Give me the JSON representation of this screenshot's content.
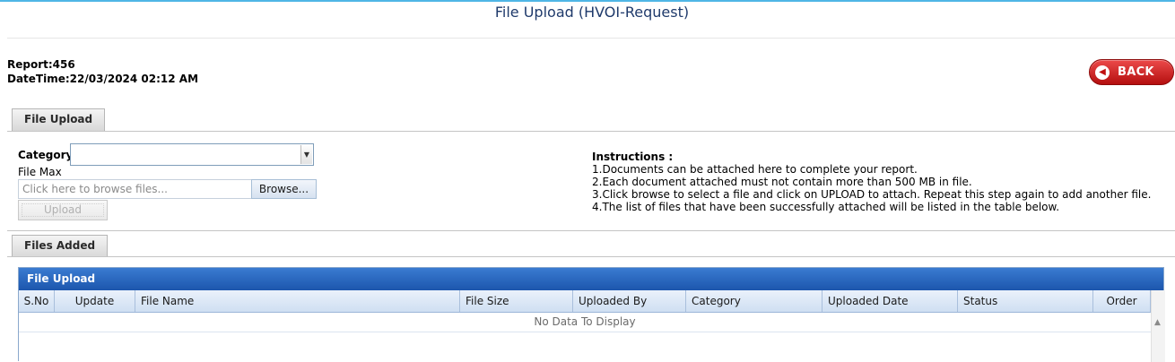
{
  "page": {
    "title": "File Upload (HVOI-Request)"
  },
  "report": {
    "report_line": "Report:456",
    "datetime_line": "DateTime:22/03/2024 02:12 AM"
  },
  "back_button": {
    "label": "BACK"
  },
  "upload_tab": {
    "label": "File Upload"
  },
  "form": {
    "category_label": "Category",
    "category_value": "",
    "file_max_label": "File Max",
    "file_placeholder": "Click here to browse files...",
    "browse_label": "Browse...",
    "upload_label": "Upload"
  },
  "instructions": {
    "heading": "Instructions :",
    "lines": [
      "1.Documents can be attached here to complete your report.",
      "2.Each document attached must not contain more than 500 MB in file.",
      "3.Click browse to select a file and click on UPLOAD to attach. Repeat this step again to add another file.",
      "4.The list of files that have been successfully attached will be listed in the table below."
    ]
  },
  "files_tab": {
    "label": "Files Added"
  },
  "grid": {
    "title": "File Upload",
    "columns": [
      "S.No",
      "Update",
      "File Name",
      "File Size",
      "Uploaded By",
      "Category",
      "Uploaded Date",
      "Status",
      "Order"
    ],
    "empty_text": "No Data To Display"
  },
  "colors": {
    "accent": "#1c56ad",
    "back_button": "#d41f1f",
    "title_text": "#1f3a6b"
  }
}
